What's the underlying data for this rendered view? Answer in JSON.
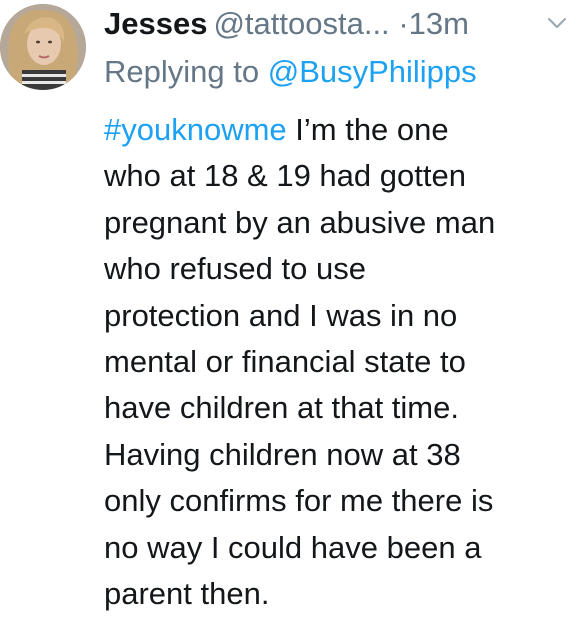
{
  "tweet": {
    "display_name": "Jesses",
    "handle": "@tattoosta...",
    "time_separator": "·",
    "time": "13m",
    "reply_prefix": "Replying to",
    "reply_to": "@BusyPhilipps",
    "hashtag": "#youknowme",
    "lines": [
      " I’m the one",
      "who at 18 & 19 had gotten",
      "pregnant by an abusive man",
      "who refused to use",
      "protection and I was in no",
      "mental or financial state to",
      "have children at that time.",
      "Having children now at 38",
      "only confirms for me there is",
      "no way I could have been a",
      "parent then."
    ]
  },
  "icons": {
    "menu": "chevron-down-icon",
    "avatar": "profile-photo"
  },
  "colors": {
    "text": "#14171a",
    "secondary": "#657786",
    "link": "#1da1f2"
  }
}
